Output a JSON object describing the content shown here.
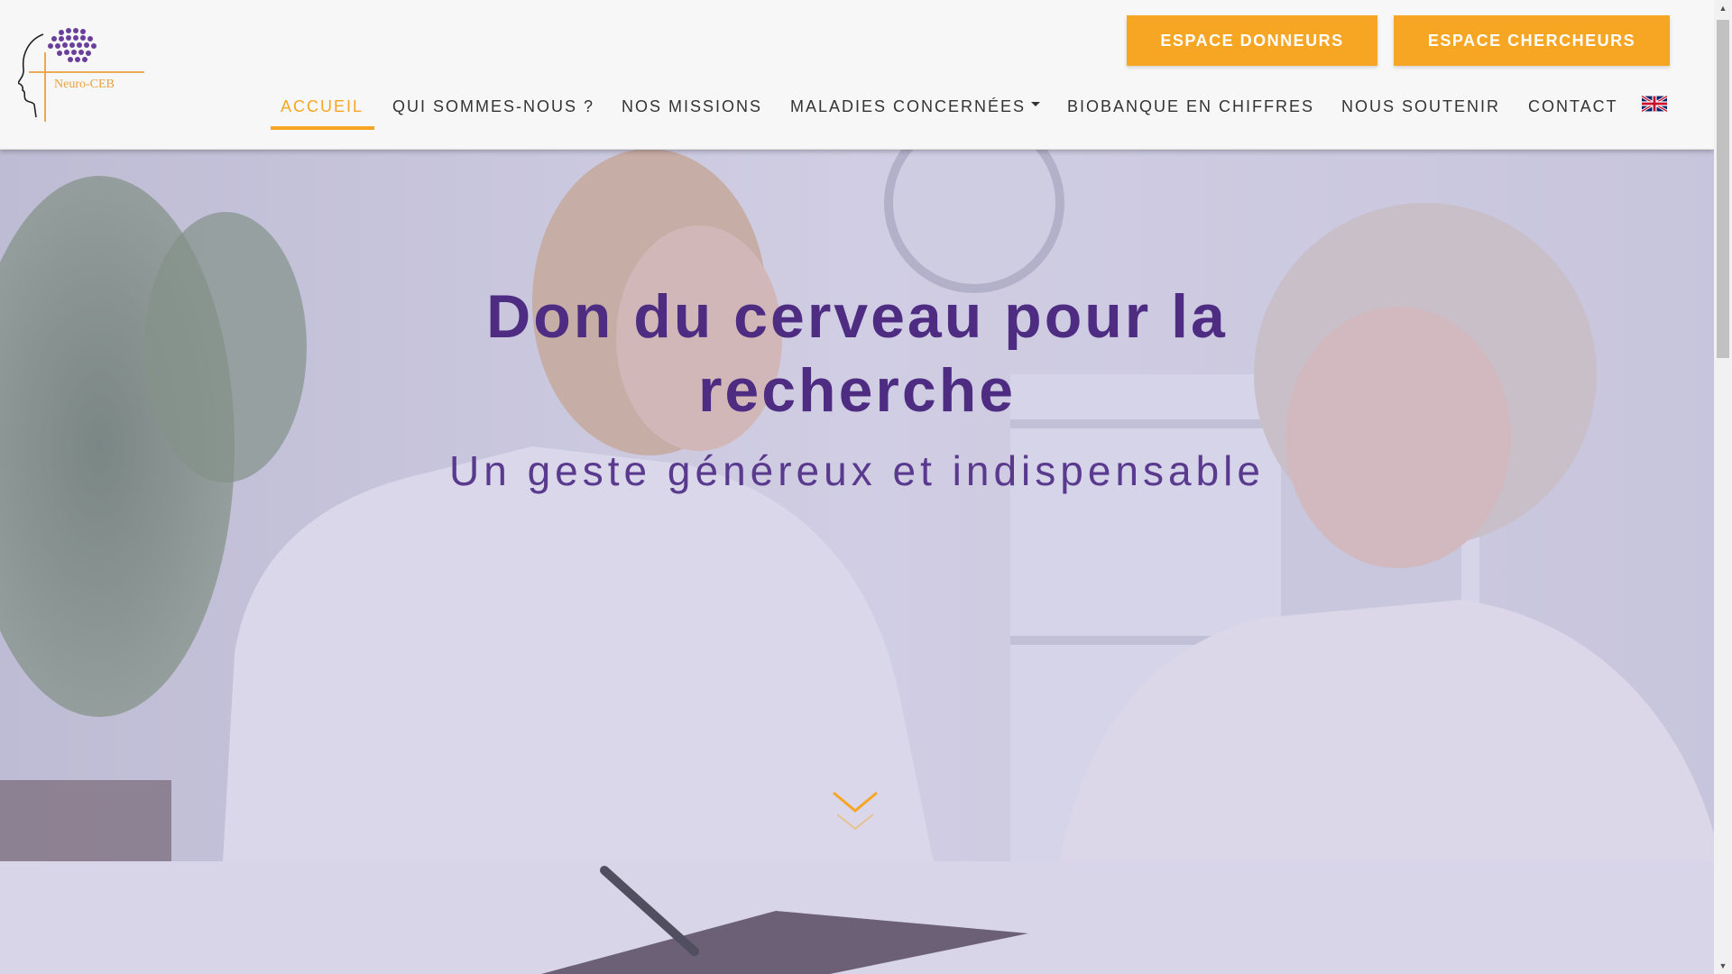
{
  "brand": {
    "name": "Neuro-CEB"
  },
  "header": {
    "cta_donneurs": "ESPACE DONNEURS",
    "cta_chercheurs": "ESPACE CHERCHEURS"
  },
  "nav": {
    "items": [
      {
        "label": "ACCUEIL",
        "active": true
      },
      {
        "label": "QUI SOMMES-NOUS ?"
      },
      {
        "label": "NOS MISSIONS"
      },
      {
        "label": "MALADIES CONCERNÉES",
        "dropdown": true
      },
      {
        "label": "BIOBANQUE EN CHIFFRES"
      },
      {
        "label": "NOUS SOUTENIR"
      },
      {
        "label": "CONTACT"
      }
    ],
    "language_icon": "uk-flag-icon"
  },
  "hero": {
    "title": "Don du cerveau pour la recherche",
    "subtitle": "Un geste généreux et indispensable",
    "scroll_icon": "chevron-down-icon"
  },
  "colors": {
    "accent": "#f6a623",
    "brand_purple": "#4e2c82",
    "header_bg": "#f7f7f7"
  }
}
